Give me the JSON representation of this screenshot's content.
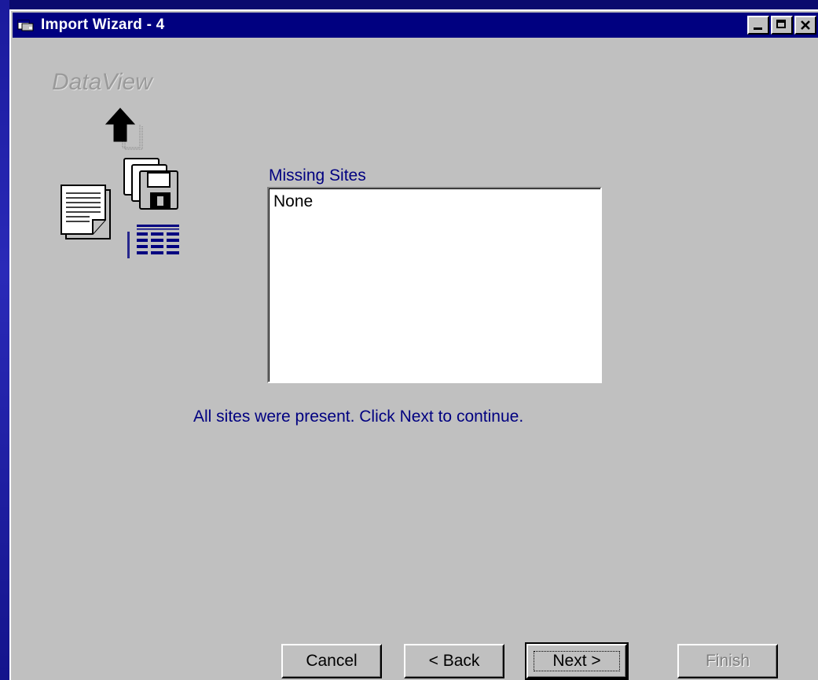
{
  "window": {
    "title": "Import Wizard - 4"
  },
  "brand": {
    "logo_text": "DataView"
  },
  "icons": [
    "window-app-icon",
    "upload-arrow-icon",
    "floppy-disks-icon",
    "document-icon",
    "table-grid-icon",
    "minimize-icon",
    "maximize-icon",
    "close-icon"
  ],
  "missing_sites": {
    "label": "Missing Sites",
    "items": [
      "None"
    ]
  },
  "status": {
    "message": "All sites were present. Click Next to continue."
  },
  "buttons": {
    "cancel": "Cancel",
    "back": "< Back",
    "next": "Next >",
    "finish": "Finish"
  },
  "colors": {
    "titlebar": "#000080",
    "dialog_bg": "#c0c0c0",
    "label_text": "#000080",
    "desktop": "#0b0b7a"
  }
}
